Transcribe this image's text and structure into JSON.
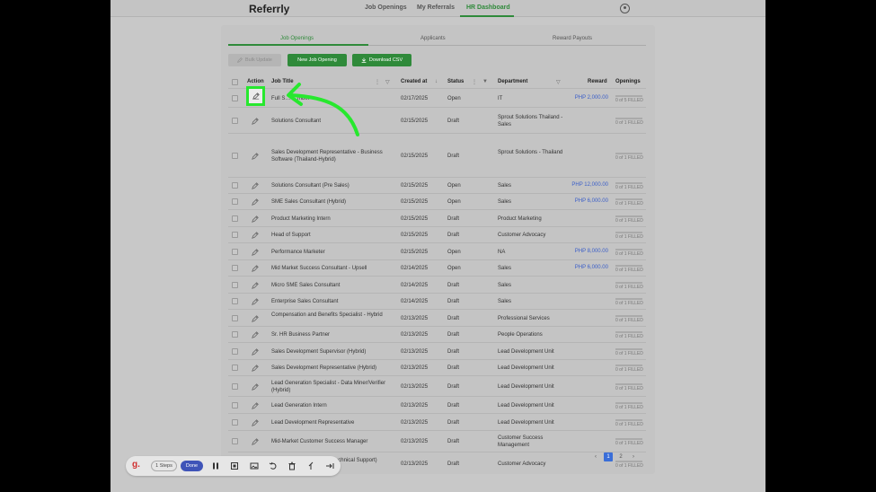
{
  "app": {
    "logo": "Referrly"
  },
  "nav": {
    "items": [
      {
        "label": "Job Openings"
      },
      {
        "label": "My Referrals"
      },
      {
        "label": "HR Dashboard",
        "active": true
      }
    ]
  },
  "tabs": [
    {
      "label": "Job Openings",
      "active": true
    },
    {
      "label": "Applicants"
    },
    {
      "label": "Reward Payouts"
    }
  ],
  "actions": {
    "bulk_update": "Bulk Update",
    "new_job": "New Job Opening",
    "download_csv": "Download CSV"
  },
  "table": {
    "headers": {
      "action": "Action",
      "job_title": "Job Title",
      "created_at": "Created at",
      "status": "Status",
      "department": "Department",
      "reward": "Reward",
      "openings": "Openings"
    },
    "rows": [
      {
        "title": "Full S… …mber",
        "created": "02/17/2025",
        "status": "Open",
        "dept": "IT",
        "reward": "PHP 2,000.00",
        "openings": "0 of 5 FILLED"
      },
      {
        "title": "Solutions Consultant",
        "created": "02/15/2025",
        "status": "Draft",
        "dept": "Sprout Solutions Thailand - Sales",
        "reward": "",
        "openings": "0 of 1 FILLED"
      },
      {
        "title": "Sales Development Representative - Business Software (Thailand-Hybrid)",
        "created": "02/15/2025",
        "status": "Draft",
        "dept": "Sprout Solutions - Thailand",
        "reward": "",
        "openings": "0 of 1 FILLED"
      },
      {
        "title": "Solutions Consultant (Pre Sales)",
        "created": "02/15/2025",
        "status": "Open",
        "dept": "Sales",
        "reward": "PHP 12,000.00",
        "openings": "0 of 1 FILLED"
      },
      {
        "title": "SME Sales Consultant (Hybrid)",
        "created": "02/15/2025",
        "status": "Open",
        "dept": "Sales",
        "reward": "PHP 6,000.00",
        "openings": "0 of 1 FILLED"
      },
      {
        "title": "Product Marketing Intern",
        "created": "02/15/2025",
        "status": "Draft",
        "dept": "Product Marketing",
        "reward": "",
        "openings": "0 of 1 FILLED"
      },
      {
        "title": "Head of Support",
        "created": "02/15/2025",
        "status": "Draft",
        "dept": "Customer Advocacy",
        "reward": "",
        "openings": "0 of 1 FILLED"
      },
      {
        "title": "Performance Marketer",
        "created": "02/15/2025",
        "status": "Open",
        "dept": "NA",
        "reward": "PHP 8,000.00",
        "openings": "0 of 1 FILLED"
      },
      {
        "title": "Mid Market Success Consultant - Upsell",
        "created": "02/14/2025",
        "status": "Open",
        "dept": "Sales",
        "reward": "PHP 6,000.00",
        "openings": "0 of 1 FILLED"
      },
      {
        "title": "Micro SME Sales Consultant",
        "created": "02/14/2025",
        "status": "Draft",
        "dept": "Sales",
        "reward": "",
        "openings": "0 of 1 FILLED"
      },
      {
        "title": "Enterprise Sales Consultant",
        "created": "02/14/2025",
        "status": "Draft",
        "dept": "Sales",
        "reward": "",
        "openings": "0 of 1 FILLED"
      },
      {
        "title": "Compensation and Benefits Specialist - Hybrid",
        "created": "02/13/2025",
        "status": "Draft",
        "dept": "Professional Services",
        "reward": "",
        "openings": "0 of 1 FILLED"
      },
      {
        "title": "Sr. HR Business Partner",
        "created": "02/13/2025",
        "status": "Draft",
        "dept": "People Operations",
        "reward": "",
        "openings": "0 of 1 FILLED"
      },
      {
        "title": "Sales Development Supervisor (Hybrid)",
        "created": "02/13/2025",
        "status": "Draft",
        "dept": "Lead Development Unit",
        "reward": "",
        "openings": "0 of 1 FILLED"
      },
      {
        "title": "Sales Development Representative (Hybrid)",
        "created": "02/13/2025",
        "status": "Draft",
        "dept": "Lead Development Unit",
        "reward": "",
        "openings": "0 of 1 FILLED"
      },
      {
        "title": "Lead Generation Specialist - Data Miner/Verifier (Hybrid)",
        "created": "02/13/2025",
        "status": "Draft",
        "dept": "Lead Development Unit",
        "reward": "",
        "openings": "0 of 1 FILLED"
      },
      {
        "title": "Lead Generation Intern",
        "created": "02/13/2025",
        "status": "Draft",
        "dept": "Lead Development Unit",
        "reward": "",
        "openings": "0 of 1 FILLED"
      },
      {
        "title": "Lead Development Representative",
        "created": "02/13/2025",
        "status": "Draft",
        "dept": "Lead Development Unit",
        "reward": "",
        "openings": "0 of 1 FILLED"
      },
      {
        "title": "Mid-Market Customer Success Manager",
        "created": "02/13/2025",
        "status": "Draft",
        "dept": "Customer Success Management",
        "reward": "",
        "openings": "0 of 1 FILLED"
      },
      {
        "title": "Customer Advocate (L1 - Technical Support) (Hybrid)",
        "created": "02/13/2025",
        "status": "Draft",
        "dept": "Customer Advocacy",
        "reward": "",
        "openings": "0 of 1 FILLED"
      }
    ]
  },
  "pagination": {
    "prev": "‹",
    "pages": [
      "1",
      "2"
    ],
    "next": "›",
    "current": "1"
  },
  "toolbar": {
    "logo": "g.",
    "steps": "1 Steps",
    "done": "Done"
  },
  "colors": {
    "accent": "#2f8a3a",
    "highlight": "#27e82e",
    "link": "#3a5ec8",
    "page_active": "#3a6ed8"
  }
}
